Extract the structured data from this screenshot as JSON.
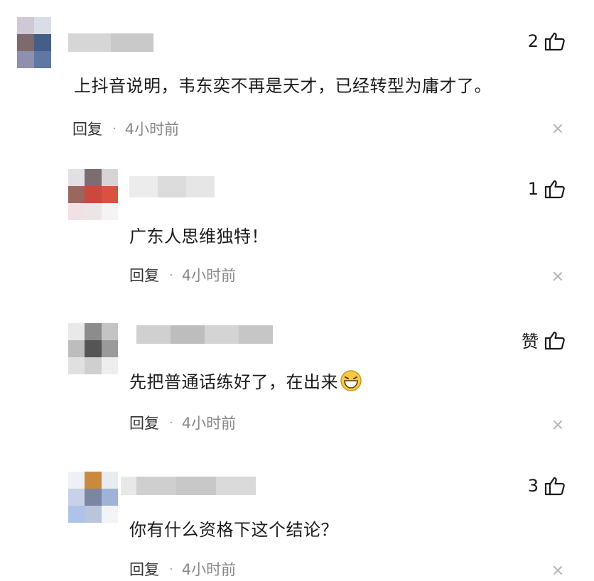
{
  "comments": [
    {
      "text": "上抖音说明，韦东奕不再是天才，已经转型为庸才了。",
      "likes": "2",
      "reply_label": "回复",
      "separator": "·",
      "time": "4小时前"
    },
    {
      "text": "广东人思维独特！",
      "likes": "1",
      "reply_label": "回复",
      "separator": "·",
      "time": "4小时前"
    },
    {
      "text": "先把普通话练好了，在出来",
      "likes": "赞",
      "emoji": "grin-emoji",
      "reply_label": "回复",
      "separator": "·",
      "time": "4小时前"
    },
    {
      "text": "你有什么资格下这个结论？",
      "likes": "3",
      "reply_label": "回复",
      "separator": "·",
      "time": "4小时前"
    }
  ],
  "icons": {
    "like": "thumbs-up-icon",
    "delete": "close-icon",
    "avatar": "blurred-avatar"
  },
  "colors": {
    "text": "#1a1a1a",
    "meta": "#888888",
    "close": "#b5b5b5",
    "emoji_fill": "#f7c948"
  }
}
